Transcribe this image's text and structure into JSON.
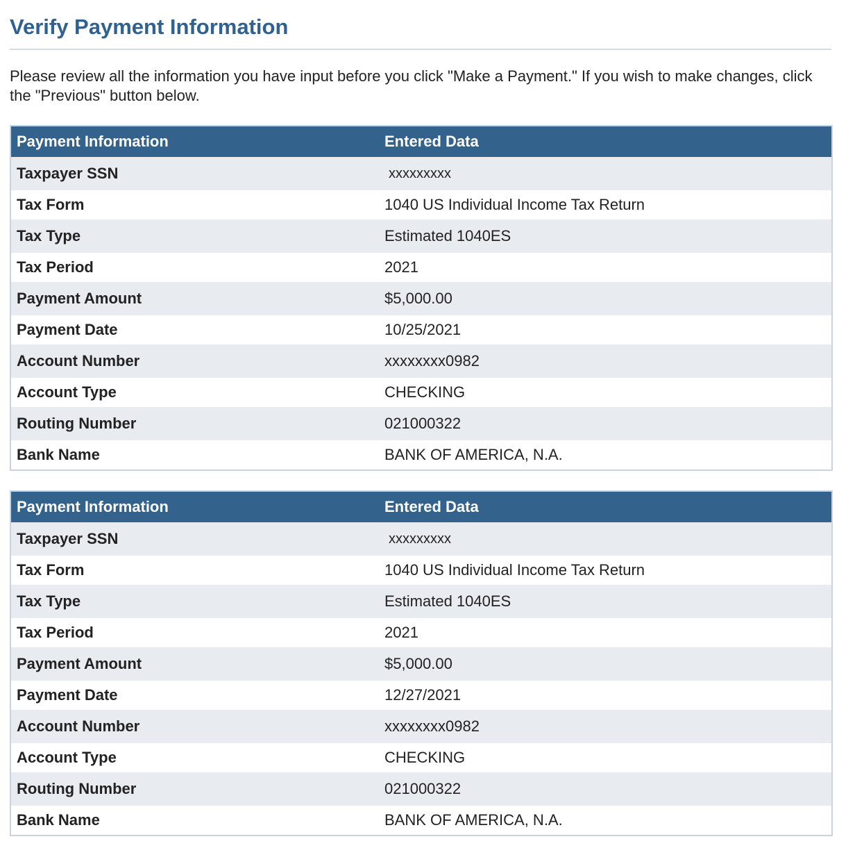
{
  "page": {
    "title": "Verify Payment Information",
    "intro": "Please review all the information you have input before you click \"Make a Payment.\" If you wish to make changes, click the \"Previous\" button below."
  },
  "colors": {
    "title": "#2f6191",
    "table_header": "#33628d",
    "row_alt": "#e8ecf1"
  },
  "tables": [
    {
      "header": {
        "col1": "Payment Information",
        "col2": "Entered Data"
      },
      "rows": [
        {
          "label": "Taxpayer SSN",
          "value": "xxxxxxxxx"
        },
        {
          "label": "Tax Form",
          "value": "1040 US Individual Income Tax Return"
        },
        {
          "label": "Tax Type",
          "value": "Estimated 1040ES"
        },
        {
          "label": "Tax Period",
          "value": "2021"
        },
        {
          "label": "Payment Amount",
          "value": "$5,000.00"
        },
        {
          "label": "Payment Date",
          "value": "10/25/2021"
        },
        {
          "label": "Account Number",
          "value": "xxxxxxxx0982"
        },
        {
          "label": "Account Type",
          "value": "CHECKING"
        },
        {
          "label": "Routing Number",
          "value": "021000322"
        },
        {
          "label": "Bank Name",
          "value": "BANK OF AMERICA, N.A."
        }
      ]
    },
    {
      "header": {
        "col1": "Payment Information",
        "col2": "Entered Data"
      },
      "rows": [
        {
          "label": "Taxpayer SSN",
          "value": "xxxxxxxxx"
        },
        {
          "label": "Tax Form",
          "value": "1040 US Individual Income Tax Return"
        },
        {
          "label": "Tax Type",
          "value": "Estimated 1040ES"
        },
        {
          "label": "Tax Period",
          "value": "2021"
        },
        {
          "label": "Payment Amount",
          "value": "$5,000.00"
        },
        {
          "label": "Payment Date",
          "value": "12/27/2021"
        },
        {
          "label": "Account Number",
          "value": "xxxxxxxx0982"
        },
        {
          "label": "Account Type",
          "value": "CHECKING"
        },
        {
          "label": "Routing Number",
          "value": "021000322"
        },
        {
          "label": "Bank Name",
          "value": "BANK OF AMERICA, N.A."
        }
      ]
    }
  ]
}
